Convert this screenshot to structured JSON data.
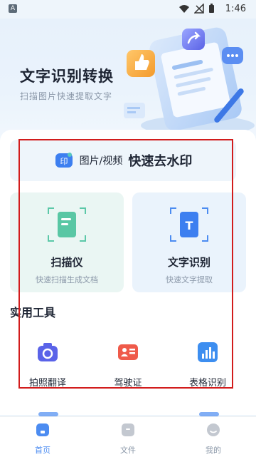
{
  "status_bar": {
    "time": "1:46",
    "app_icon": "A"
  },
  "hero": {
    "title": "文字识别转换",
    "subtitle": "扫描图片快速提取文字"
  },
  "banner": {
    "small_text": "图片/视频",
    "big_text": "快速去水印",
    "icon": "watermark-stamp-icon"
  },
  "features": [
    {
      "label": "扫描仪",
      "sub": "快速扫描生成文档",
      "icon": "scan-document-icon"
    },
    {
      "label": "文字识别",
      "sub": "快速文字提取",
      "icon": "text-recognition-icon"
    }
  ],
  "tools_section": {
    "title": "实用工具"
  },
  "tools": [
    {
      "label": "拍照翻译",
      "icon": "camera-icon"
    },
    {
      "label": "驾驶证",
      "icon": "id-card-icon"
    },
    {
      "label": "表格识别",
      "icon": "bar-chart-icon"
    }
  ],
  "nav": [
    {
      "label": "首页",
      "icon": "home-icon",
      "active": true
    },
    {
      "label": "文件",
      "icon": "file-box-icon",
      "active": false
    },
    {
      "label": "我的",
      "icon": "user-icon",
      "active": false
    }
  ],
  "colors": {
    "primary": "#4c8cf1",
    "highlight_border": "#d21c1c",
    "text_dark": "#1d2433",
    "text_muted": "#8a97a8"
  }
}
